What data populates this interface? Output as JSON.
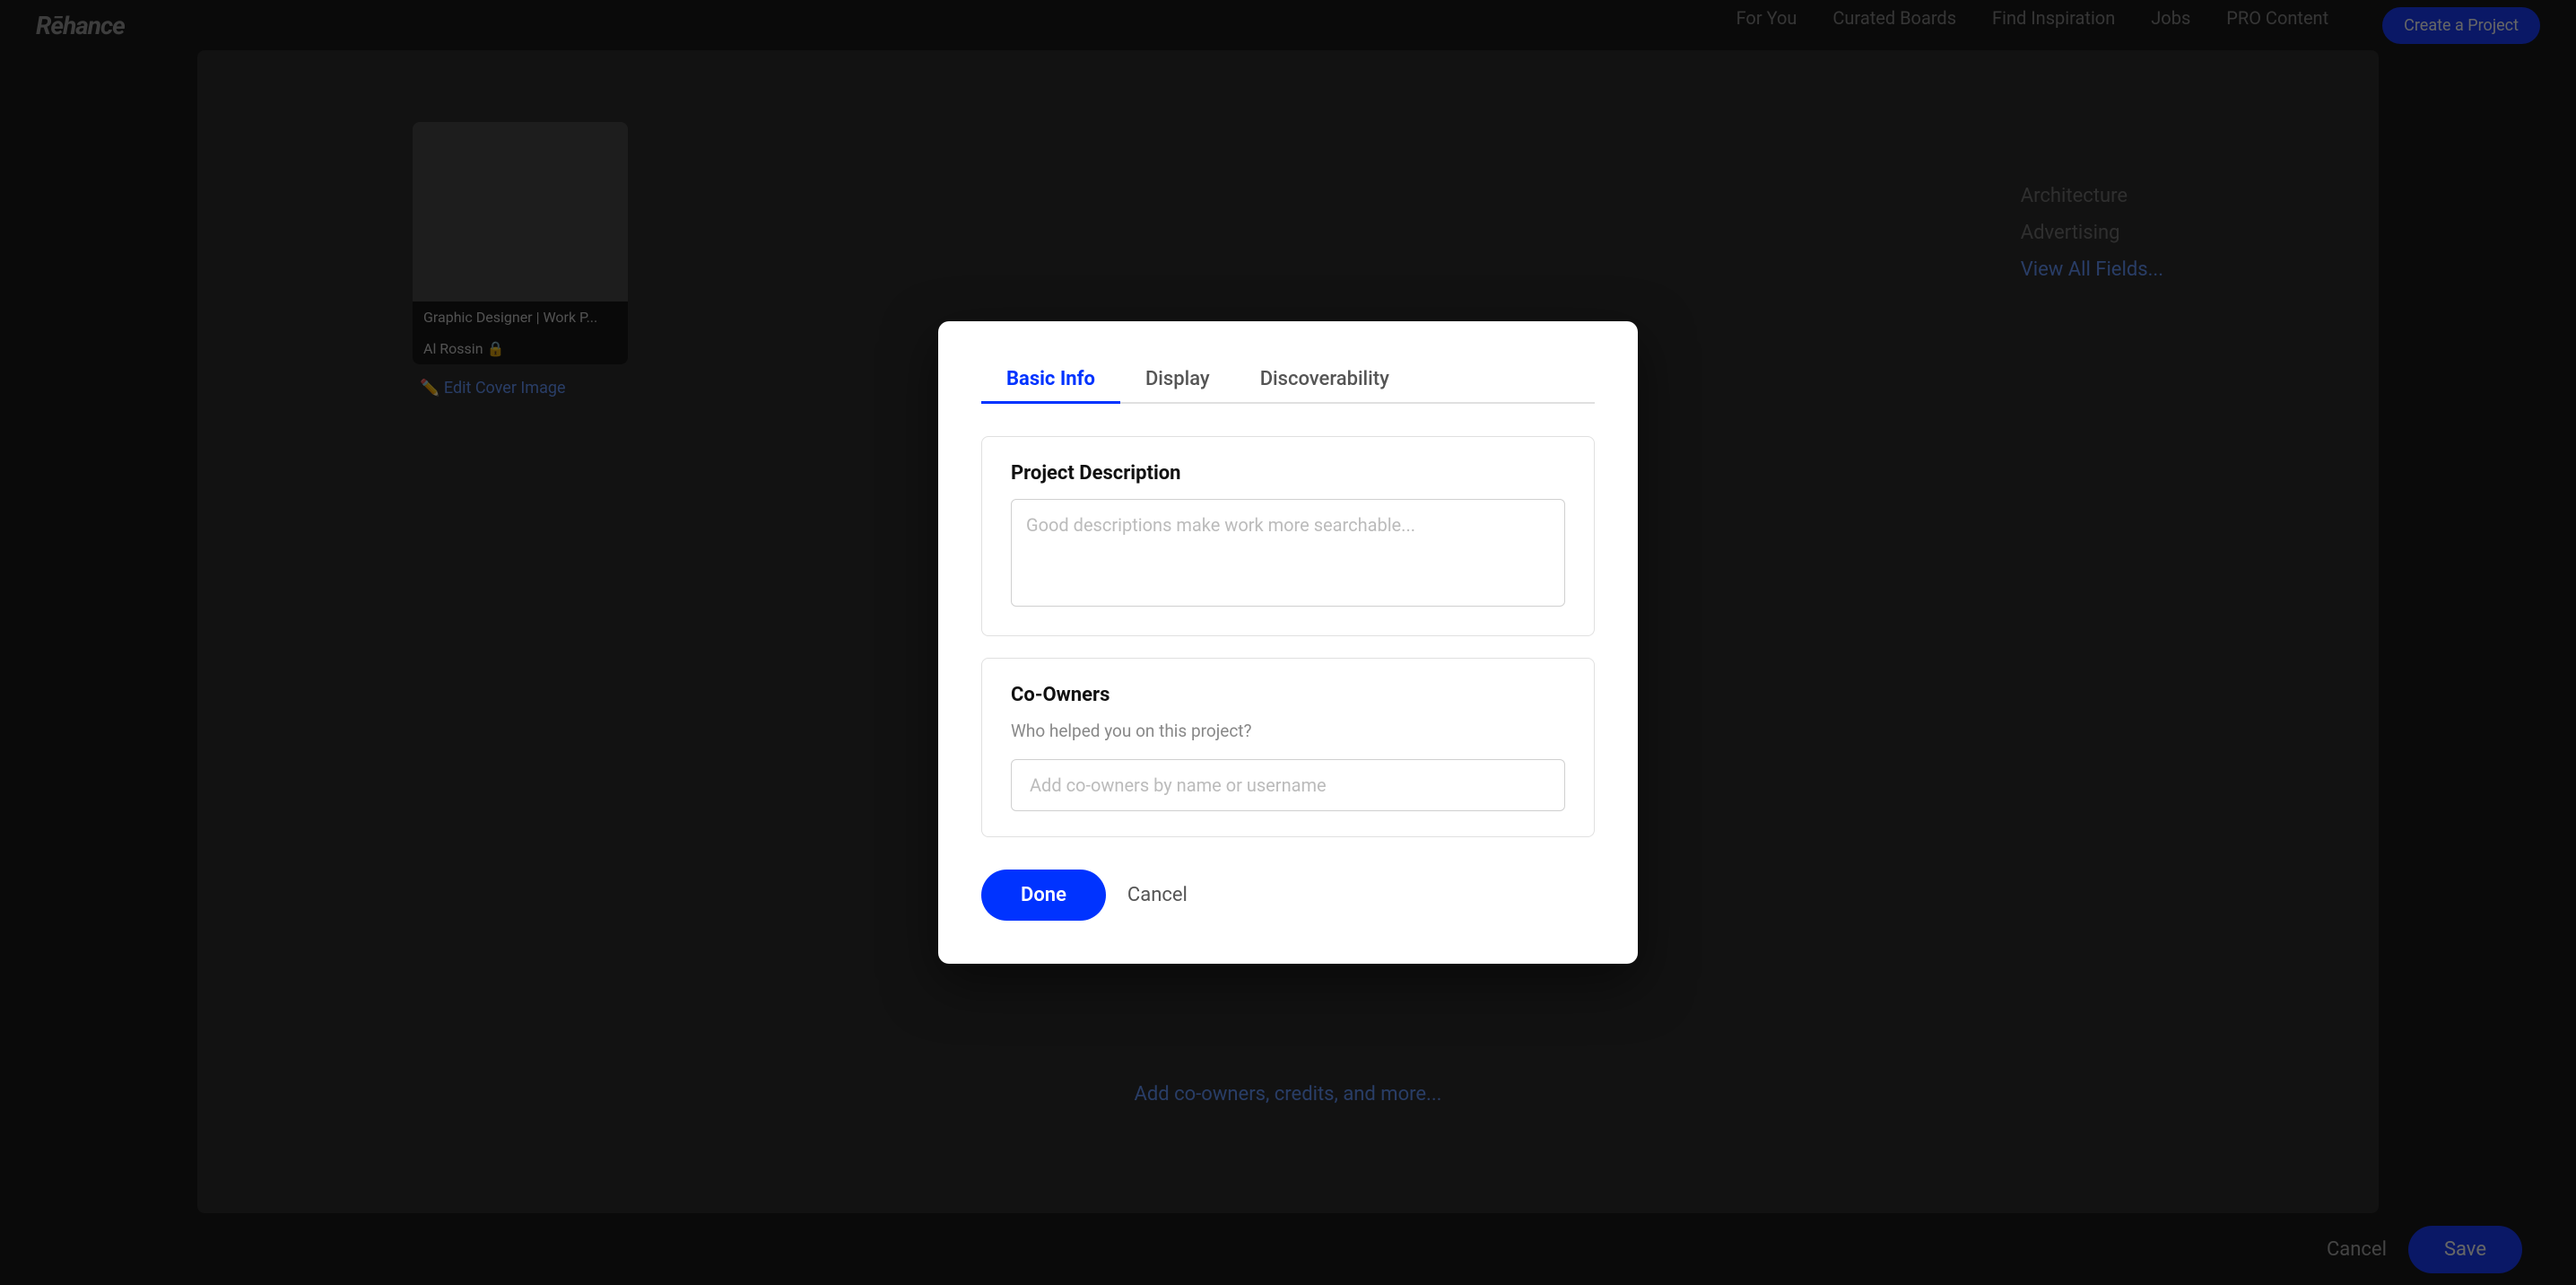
{
  "app": {
    "logo": "Rēhance",
    "nav": [
      "For You",
      "Curated Boards",
      "Find Inspiration",
      "Jobs",
      "PRO Content"
    ],
    "cta_label": "Create a Project"
  },
  "background": {
    "card_label": "Graphic Designer | Work P...",
    "user_label": "Al Rossin 🔒",
    "edit_cover": "Edit Cover Image",
    "link_text": "Add co-owners, credits, and more...",
    "sidebar_items": [
      "Architecture",
      "Advertising",
      "View All Fields..."
    ],
    "cancel_label": "Cancel",
    "save_label": "Save"
  },
  "modal": {
    "tabs": [
      {
        "id": "basic-info",
        "label": "Basic Info",
        "active": true
      },
      {
        "id": "display",
        "label": "Display",
        "active": false
      },
      {
        "id": "discoverability",
        "label": "Discoverability",
        "active": false
      }
    ],
    "project_description": {
      "section_title": "Project Description",
      "placeholder": "Good descriptions make work more searchable..."
    },
    "co_owners": {
      "section_title": "Co-Owners",
      "subtitle": "Who helped you on this project?",
      "input_placeholder": "Add co-owners by name or username"
    },
    "footer": {
      "done_label": "Done",
      "cancel_label": "Cancel"
    }
  }
}
